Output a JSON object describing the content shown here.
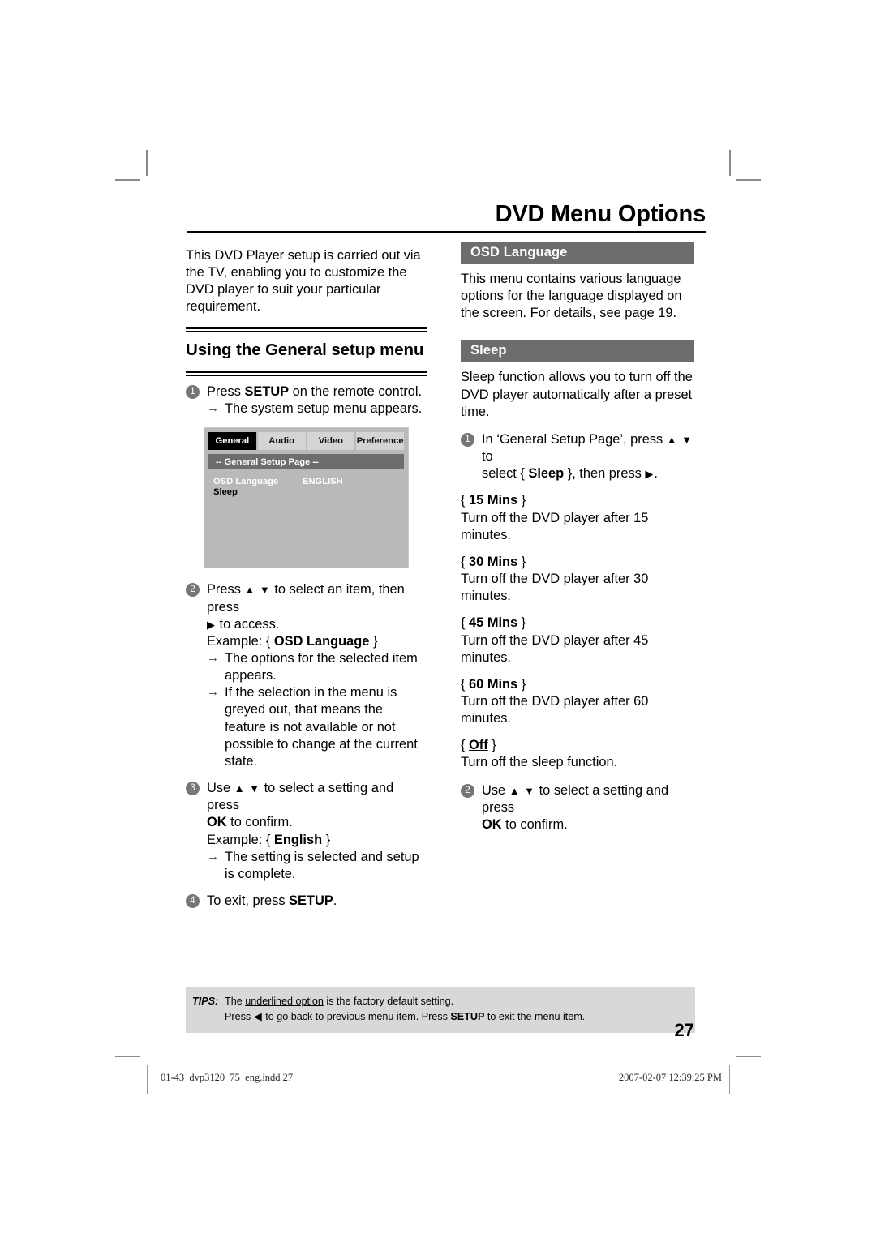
{
  "header": {
    "title": "DVD Menu Options"
  },
  "left_column": {
    "intro_paragraph": "This DVD Player setup is carried out via the TV, enabling you to customize the DVD player to suit your particular requirement.",
    "section_heading": "Using the General setup menu",
    "steps": [
      {
        "number": "1",
        "text_before_bold": "Press ",
        "bold": "SETUP",
        "text_after_bold": " on the remote control.",
        "subs": [
          {
            "arrow": "→",
            "text": "The system setup menu appears."
          }
        ]
      },
      {
        "number": "2",
        "line1_a": "Press ",
        "line1_icons": "▲ ▼",
        "line1_b": " to select an item, then press",
        "line2_icon": "▶",
        "line2_b": " to access.",
        "example_prefix": "Example: {",
        "example_bold": "OSD Language",
        "example_suffix": "}",
        "subs": [
          {
            "arrow": "→",
            "text": "The options for the selected item appears."
          },
          {
            "arrow": "→",
            "text": "If the selection in the menu is greyed out, that means the feature is not available or not possible to change at the current state."
          }
        ]
      },
      {
        "number": "3",
        "line1_a": "Use ",
        "line1_icons": "▲ ▼",
        "line1_b": " to select a setting and press",
        "line2_bold": "OK",
        "line2_b": " to confirm.",
        "example_prefix": "Example: {",
        "example_bold": "English",
        "example_suffix": "}",
        "subs": [
          {
            "arrow": "→",
            "text": "The setting is selected and setup is complete."
          }
        ]
      },
      {
        "number": "4",
        "text_before_bold": "To exit, press ",
        "bold": "SETUP",
        "text_after_bold": "."
      }
    ],
    "osd_screenshot": {
      "tabs": [
        {
          "label": "General",
          "active": true
        },
        {
          "label": "Audio",
          "active": false
        },
        {
          "label": "Video",
          "active": false
        },
        {
          "label": "Preference",
          "active": false
        }
      ],
      "page_bar": "-- General Setup Page  --",
      "rows": [
        {
          "label": "OSD Language",
          "value": "ENGLISH",
          "dim": false
        },
        {
          "label": "Sleep",
          "value": "",
          "dim": true
        }
      ]
    }
  },
  "right_column": {
    "osd_language": {
      "bar_title": "OSD Language",
      "body": "This menu contains various language options for the language displayed on the screen. For details, see page 19."
    },
    "sleep": {
      "bar_title": "Sleep",
      "body": "Sleep function allows you to turn off the DVD player automatically after a preset time.",
      "step1": {
        "number": "1",
        "line1_a": "In ‘General Setup Page’, press ",
        "line1_icons": "▲ ▼",
        "line1_b": " to",
        "line2_a": "select {",
        "line2_bold": "Sleep",
        "line2_b": "}, then press ",
        "line2_icon": "▶",
        "line2_end": "."
      },
      "options": [
        {
          "brace_open": "{",
          "name": "15 Mins",
          "brace_close": "}",
          "underlined": false,
          "description": "Turn off the DVD player after 15 minutes."
        },
        {
          "brace_open": "{",
          "name": "30 Mins",
          "brace_close": "}",
          "underlined": false,
          "description": "Turn off the DVD player after 30 minutes."
        },
        {
          "brace_open": "{",
          "name": "45 Mins",
          "brace_close": "}",
          "underlined": false,
          "description": "Turn off the DVD player after 45 minutes."
        },
        {
          "brace_open": "{",
          "name": "60 Mins",
          "brace_close": "}",
          "underlined": false,
          "description": "Turn off the DVD player after 60 minutes."
        },
        {
          "brace_open": "{",
          "name": "Off",
          "brace_close": "}",
          "underlined": true,
          "description": "Turn off the sleep function."
        }
      ],
      "step2": {
        "number": "2",
        "line1_a": "Use ",
        "line1_icons": "▲ ▼",
        "line1_b": " to select a setting and press",
        "line2_bold": "OK",
        "line2_b": " to confirm."
      }
    }
  },
  "tips": {
    "label": "TIPS:",
    "line1_a": "The ",
    "line1_underlined": "underlined option",
    "line1_b": " is the factory default setting.",
    "line2_a": "Press ",
    "line2_icon": "◀",
    "line2_b": " to go back to previous menu item. Press ",
    "line2_bold": "SETUP",
    "line2_c": " to exit the menu item."
  },
  "page_number": "27",
  "slug": {
    "left": "01-43_dvp3120_75_eng.indd   27",
    "right": "2007-02-07   12:39:25 PM"
  }
}
